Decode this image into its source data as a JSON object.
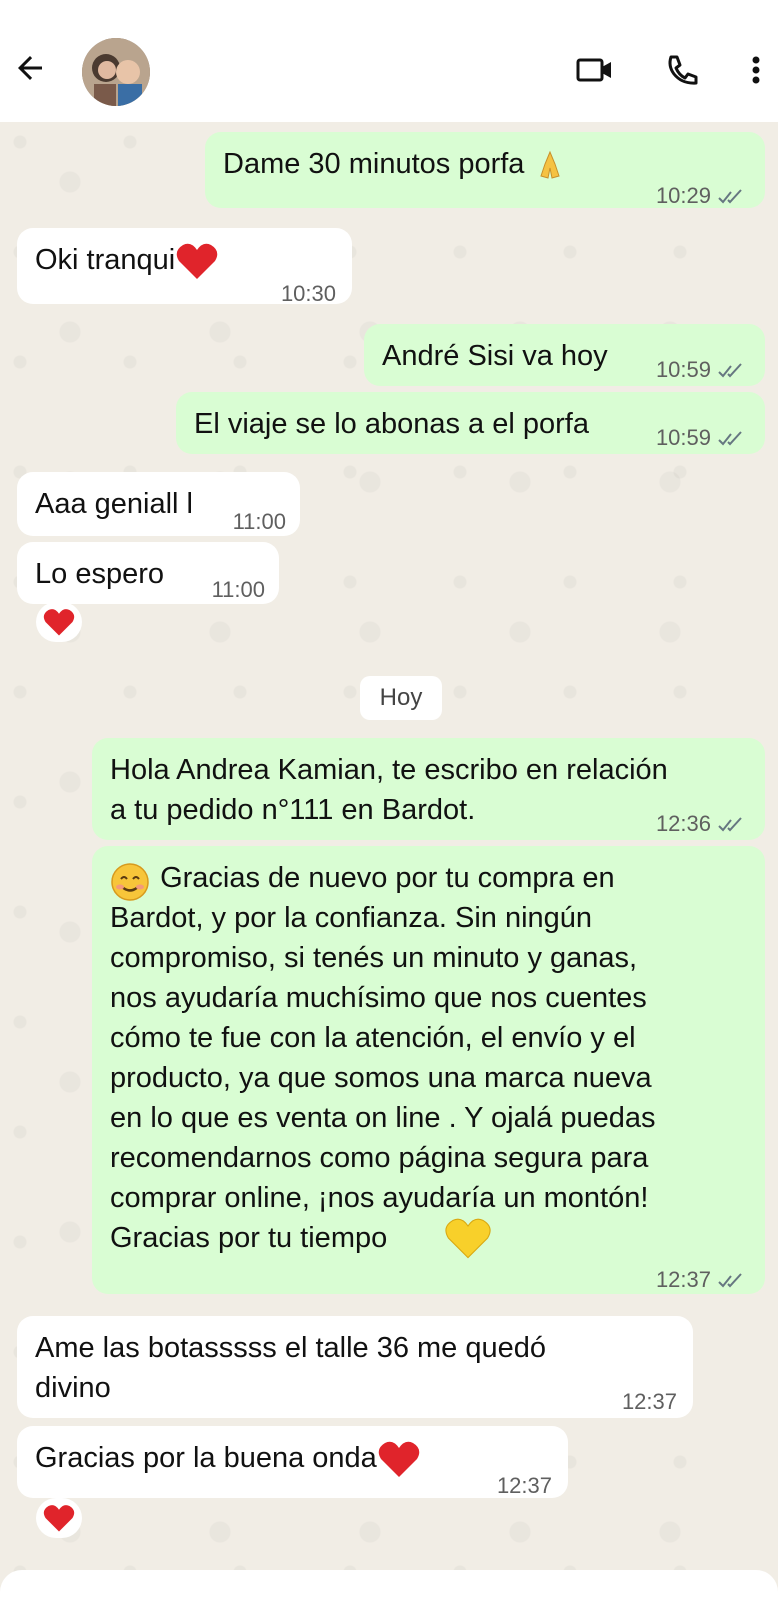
{
  "messages": [
    {
      "text": "Dame 30 minutos porfa",
      "time": "10:29"
    },
    {
      "text": "Oki tranqui",
      "time": "10:30"
    },
    {
      "text": "André Sisi va hoy",
      "time": "10:59"
    },
    {
      "text": "El viaje se lo abonas a el porfa",
      "time": "10:59"
    },
    {
      "text": "Aaa geniall l",
      "time": "11:00"
    },
    {
      "text": "Lo espero",
      "time": "11:00"
    },
    {
      "text": "Hola Andrea Kamian, te escribo en relación\na tu pedido n°111 en Bardot.",
      "time": "12:36"
    },
    {
      "text": " Gracias de nuevo por tu compra en\nBardot, y por la confianza. Sin ningún\ncompromiso, si tenés un minuto y ganas,\nnos ayudaría muchísimo que nos cuentes\ncómo te fue con la atención, el envío y el\nproducto, ya que somos una marca nueva\nen lo que es venta on line . Y ojalá puedas\nrecomendarnos como página segura para\ncomprar online, ¡nos ayudaría un montón!\nGracias por tu tiempo ",
      "time": "12:37"
    },
    {
      "text": "Ame las botasssss el talle 36 me quedó\ndivino",
      "time": "12:37"
    },
    {
      "text": "Gracias por la buena onda",
      "time": "12:37"
    }
  ],
  "day_separator": "Hoy",
  "icons": {
    "back": "arrow-left-icon",
    "video": "video-camera-icon",
    "call": "phone-icon",
    "menu": "more-vertical-icon",
    "read": "double-check-icon",
    "heart": "red-heart-emoji",
    "pray": "folded-hands-emoji",
    "smile": "smiling-face-emoji",
    "yellow_heart": "yellow-heart-emoji"
  },
  "colors": {
    "outgoing": "#d9fdd3",
    "incoming": "#ffffff",
    "tick": "#667781"
  }
}
